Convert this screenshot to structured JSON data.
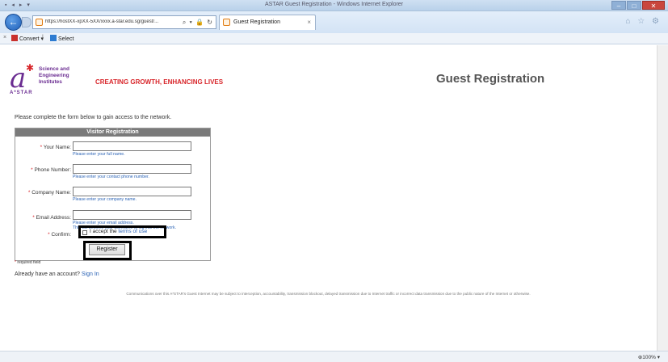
{
  "browser": {
    "title": "ASTAR Guest Registration - Windows Internet Explorer",
    "url": "https://hostXX-xpXX-5XX/xxxx.a-star.edu.sg/guest/...",
    "tab_label": "Guest Registration",
    "command_bar": {
      "convert_label": "Convert",
      "select_label": "Select"
    },
    "zoom": "100%"
  },
  "header": {
    "org_lines": [
      "Science and",
      "Engineering",
      "Institutes"
    ],
    "astar": "A*STAR",
    "tagline": "CREATING GROWTH, ENHANCING LIVES",
    "page_title": "Guest Registration"
  },
  "intro": "Please complete the form below to gain access to the network.",
  "form": {
    "heading": "Visitor Registration",
    "fields": [
      {
        "label": "Your Name:",
        "hint": "Please enter your full name."
      },
      {
        "label": "Phone Number:",
        "hint": "Please enter your contact phone number."
      },
      {
        "label": "Company Name:",
        "hint": "Please enter your company name."
      },
      {
        "label": "Email Address:",
        "hint": "Please enter your email address.",
        "hint2": "This will become your username to log into the network."
      }
    ],
    "confirm_label": "Confirm:",
    "accept_prefix": "I accept the",
    "terms_link": "terms of use",
    "register_label": "Register"
  },
  "required_note": "required field",
  "already_text": "Already have an account?",
  "signin_link": "Sign In",
  "disclaimer": "Communications over this A*STAR's Guest Internet may be subject to interception, accountability, transmission blockout, delayed transmission due to Internet traffic or incorrect data transmission due to the public nature of the Internet or otherwise."
}
